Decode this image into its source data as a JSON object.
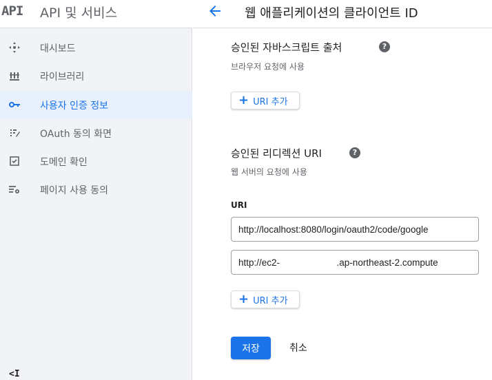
{
  "sidebar": {
    "logo": "API",
    "title": "API 및 서비스",
    "items": [
      {
        "label": "대시보드",
        "icon": "dashboard-icon"
      },
      {
        "label": "라이브러리",
        "icon": "library-icon"
      },
      {
        "label": "사용자 인증 정보",
        "icon": "key-icon"
      },
      {
        "label": "OAuth 동의 화면",
        "icon": "oauth-consent-icon"
      },
      {
        "label": "도메인 확인",
        "icon": "domain-check-icon"
      },
      {
        "label": "페이지 사용 동의",
        "icon": "page-usage-icon"
      }
    ],
    "active_index": 2,
    "collapse_label": "<I"
  },
  "header": {
    "title": "웹 애플리케이션의 클라이언트 ID"
  },
  "js_origins": {
    "title": "승인된 자바스크립트 출처",
    "subtitle": "브라우저 요청에 사용",
    "add_button": "URI 추가"
  },
  "redirects": {
    "title": "승인된 리디렉션 URI",
    "subtitle": "웹 서버의 요청에 사용",
    "field_label": "URI",
    "uris": [
      "http://localhost:8080/login/oauth2/code/google",
      "http://ec2-                      .ap-northeast-2.compute"
    ],
    "add_button": "URI 추가"
  },
  "actions": {
    "save": "저장",
    "cancel": "취소"
  },
  "colors": {
    "accent": "#1a73e8",
    "sidebar_bg": "#f1f3f4",
    "active_bg": "#e8f0fe"
  }
}
